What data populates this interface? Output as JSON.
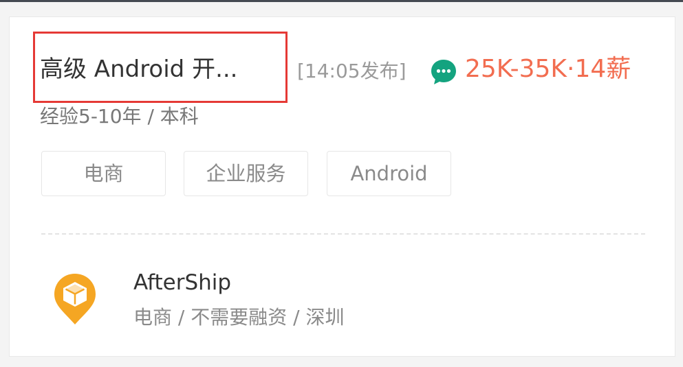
{
  "job": {
    "title": "高级 Android 开...",
    "publish_time": "[14:05发布]",
    "salary": "25K-35K·14薪",
    "requirements": "经验5-10年 / 本科",
    "tags": [
      "电商",
      "企业服务",
      "Android"
    ]
  },
  "company": {
    "name": "AfterShip",
    "info": "电商 / 不需要融资 / 深圳",
    "logo_icon": "cube-location-pin-icon"
  },
  "icons": {
    "chat": "chat-bubble-icon"
  },
  "colors": {
    "salary": "#f26d50",
    "chat_icon": "#14a37f",
    "highlight_border": "#e53935",
    "logo": "#f5a623"
  }
}
